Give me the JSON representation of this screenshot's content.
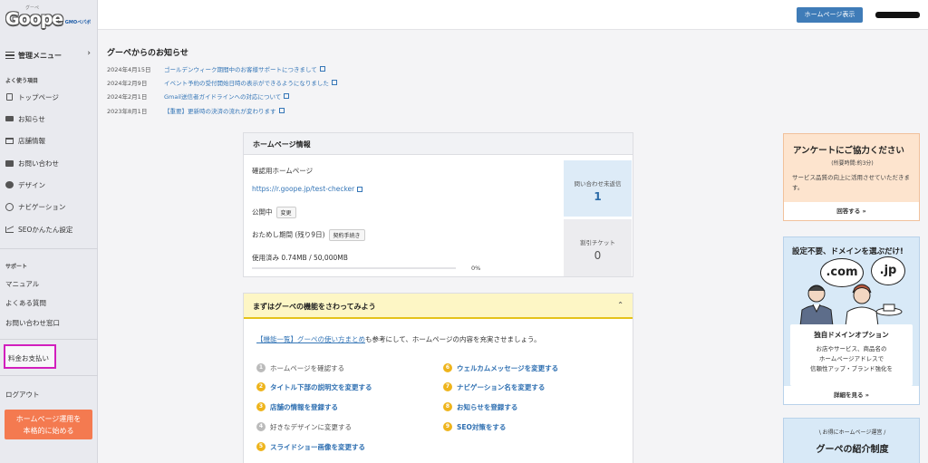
{
  "logo": {
    "brand": "Goope",
    "kana": "グーペ",
    "by": "by",
    "gmo": "GMOペパボ"
  },
  "sidebar": {
    "menu_label": "管理メニュー",
    "frequent_title": "よく使う項目",
    "items": [
      {
        "label": "トップページ",
        "icon": "page-icon"
      },
      {
        "label": "お知らせ",
        "icon": "message-icon"
      },
      {
        "label": "店舗情報",
        "icon": "store-icon"
      },
      {
        "label": "お問い合わせ",
        "icon": "mail-icon"
      },
      {
        "label": "デザイン",
        "icon": "palette-icon"
      },
      {
        "label": "ナビゲーション",
        "icon": "navigation-icon"
      },
      {
        "label": "SEOかんたん設定",
        "icon": "chart-icon"
      }
    ],
    "support_title": "サポート",
    "support_items": [
      "マニュアル",
      "よくある質問",
      "お問い合わせ窓口"
    ],
    "billing": "料金お支払い",
    "logout": "ログアウト",
    "cta_line1": "ホームページ運用を",
    "cta_line2": "本格的に始める"
  },
  "header": {
    "view_site": "ホームページ表示"
  },
  "notices": {
    "title": "グーペからのお知らせ",
    "items": [
      {
        "date": "2024年4月15日",
        "text": "ゴールデンウィーク期間中のお客様サポートにつきまして"
      },
      {
        "date": "2024年2月9日",
        "text": "イベント予約の受付開始日時の表示ができるようになりました"
      },
      {
        "date": "2024年2月1日",
        "text": "Gmail送信者ガイドラインへの対応について"
      },
      {
        "date": "2023年8月1日",
        "text": "【重要】更新時の決済の流れが変わります"
      }
    ]
  },
  "hp_info": {
    "title": "ホームページ情報",
    "confirm_label": "確認用ホームページ",
    "url": "https://r.goope.jp/test-checker",
    "status": "公開中",
    "change_btn": "変更",
    "trial": "おためし期間 (残り9日)",
    "contract_btn": "契約手続き",
    "usage": "使用済み 0.74MB / 50,000MB",
    "usage_pct": "0%",
    "usage_fraction": 0.0,
    "unreplied_label": "問い合わせ未返信",
    "unreplied_count": "1",
    "coupon_label": "割引チケット",
    "coupon_count": "0"
  },
  "features": {
    "title": "まずはグーペの機能をさわってみよう",
    "intro_link": "【機能一覧】グーペの使い方まとめ",
    "intro_rest": "も参考にして、ホームページの内容を充実させましょう。",
    "items": [
      {
        "n": "1",
        "text": "ホームページを確認する",
        "done": true
      },
      {
        "n": "2",
        "text": "タイトル下部の説明文を変更する",
        "done": false
      },
      {
        "n": "3",
        "text": "店舗の情報を登録する",
        "done": false
      },
      {
        "n": "4",
        "text": "好きなデザインに変更する",
        "done": true
      },
      {
        "n": "5",
        "text": "スライドショー画像を変更する",
        "done": false
      },
      {
        "n": "6",
        "text": "ウェルカムメッセージを変更する",
        "done": false
      },
      {
        "n": "7",
        "text": "ナビゲーション名を変更する",
        "done": false
      },
      {
        "n": "8",
        "text": "お知らせを登録する",
        "done": false
      },
      {
        "n": "9",
        "text": "SEO対策をする",
        "done": false
      }
    ]
  },
  "survey": {
    "title": "アンケートにご協力ください",
    "sub": "(所要時間:約3分)",
    "body": "サービス品質の向上に活用させていただきます。",
    "link": "回答する »"
  },
  "domain_banner": {
    "title": "設定不要、ドメインを選ぶだけ!",
    "bubble1": ".com",
    "bubble2": ".jp",
    "panel_title": "独自ドメインオプション",
    "line1": "お店やサービス、商品名の",
    "line2": "ホームページアドレスで",
    "line3": "信頼性アップ・ブランド強化を",
    "link": "詳細を見る »"
  },
  "referral": {
    "tag": "\\ お得にホームページ運営 /",
    "title": "グーペの紹介制度"
  },
  "colors": {
    "accent": "#3f7cb8",
    "link": "#3576b7",
    "cta": "#f47a50",
    "highlight": "#d21fbd",
    "feature_badge": "#eeb41c"
  }
}
